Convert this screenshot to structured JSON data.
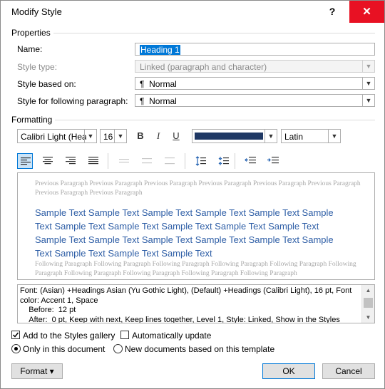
{
  "window": {
    "title": "Modify Style",
    "help_label": "?",
    "close_label": "✕"
  },
  "properties": {
    "section_label": "Properties",
    "name_label": "Name:",
    "name_value": "Heading 1",
    "style_type_label": "Style type:",
    "style_type_value": "Linked (paragraph and character)",
    "based_on_label": "Style based on:",
    "based_on_value": "Normal",
    "following_label": "Style for following paragraph:",
    "following_value": "Normal"
  },
  "formatting": {
    "section_label": "Formatting",
    "font": "Calibri Light (Heac",
    "size": "16",
    "bold": "B",
    "italic": "I",
    "underline": "U",
    "font_color": "#1f3864",
    "script": "Latin"
  },
  "preview": {
    "previous_paragraph": "Previous Paragraph Previous Paragraph Previous Paragraph Previous Paragraph Previous Paragraph Previous Paragraph Previous Paragraph Previous Paragraph",
    "sample_text": "Sample Text Sample Text Sample Text Sample Text Sample Text Sample Text Sample Text Sample Text Sample Text Sample Text Sample Text Sample Text Sample Text Sample Text Sample Text Sample Text Sample Text Sample Text Sample Text Sample Text",
    "following_paragraph": "Following Paragraph Following Paragraph Following Paragraph Following Paragraph Following Paragraph Following Paragraph Following Paragraph Following Paragraph Following Paragraph Following Paragraph"
  },
  "description": "Font: (Asian) +Headings Asian (Yu Gothic Light), (Default) +Headings (Calibri Light), 16 pt, Font color: Accent 1, Space\n    Before:  12 pt\n    After:  0 pt, Keep with next, Keep lines together, Level 1, Style: Linked, Show in the Styles",
  "options": {
    "add_to_gallery": "Add to the Styles gallery",
    "auto_update": "Automatically update",
    "only_this_doc": "Only in this document",
    "new_docs": "New documents based on this template"
  },
  "buttons": {
    "format": "Format ▾",
    "ok": "OK",
    "cancel": "Cancel"
  },
  "colors": {
    "close_button": "#e81123",
    "accent": "#0078d7",
    "sample_text": "#2e5ea6"
  }
}
